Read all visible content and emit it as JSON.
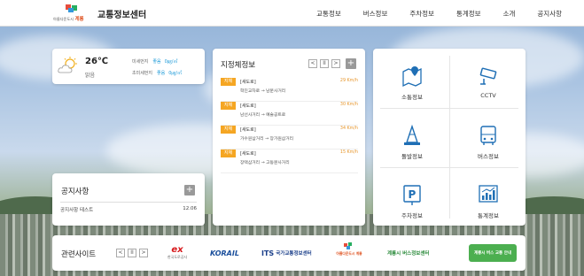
{
  "header": {
    "site_title": "교통정보센터",
    "logo_text": "아름다운도시 계룡",
    "nav": [
      "교통정보",
      "버스정보",
      "주차정보",
      "통계정보",
      "소개",
      "공지사항"
    ]
  },
  "weather": {
    "temp": "26℃",
    "sky": "맑음",
    "dust": [
      {
        "label": "미세먼지",
        "grade": "좋음",
        "value": "0㎍/㎥"
      },
      {
        "label": "초미세먼지",
        "grade": "좋음",
        "value": "0㎍/㎥"
      }
    ]
  },
  "notice": {
    "title": "공지사항",
    "items": [
      {
        "title": "공지사항 테스트",
        "date": "12.06"
      }
    ]
  },
  "congestion": {
    "title": "지정체정보",
    "controls": [
      "<",
      "II",
      ">"
    ],
    "items": [
      {
        "badge": "지체",
        "road": "[새도로]",
        "route": "학진교차로 → 남문사거리",
        "speed": "29 Km/h"
      },
      {
        "badge": "지체",
        "road": "[새도로]",
        "route": "남선사거리 → 예술공트로",
        "speed": "30 Km/h"
      },
      {
        "badge": "지체",
        "road": "[새도로]",
        "route": "가수원삼거리 → 장가원삼거리",
        "speed": "34 Km/h"
      },
      {
        "badge": "지체",
        "road": "[새도로]",
        "route": "장택삼거리 → 고동문사거리",
        "speed": "15 Km/h"
      }
    ]
  },
  "menu": [
    {
      "label": "소통정보",
      "icon": "map-icon"
    },
    {
      "label": "CCTV",
      "icon": "cctv-icon"
    },
    {
      "label": "돌발정보",
      "icon": "traffic-cone-icon"
    },
    {
      "label": "버스정보",
      "icon": "bus-icon"
    },
    {
      "label": "주차정보",
      "icon": "parking-icon"
    },
    {
      "label": "통계정보",
      "icon": "chart-icon"
    }
  ],
  "related": {
    "title": "관련사이트",
    "controls": [
      "<",
      "II",
      ">"
    ],
    "partners": [
      {
        "name": "ex",
        "sub": "한국도로공사",
        "color": "#d7191c"
      },
      {
        "name": "KORAIL",
        "sub": "",
        "color": "#1b4f9c"
      },
      {
        "name": "국가교통정보센터",
        "sub": "",
        "color": "#1b3f8a"
      },
      {
        "name": "아름다운도시 계룡",
        "sub": "",
        "color": "#e05a2a"
      },
      {
        "name": "계룡시 버스정보센터",
        "sub": "",
        "color": "#2a8a3a"
      },
      {
        "name": "계룡시 버스 교통 안내",
        "sub": "",
        "color": "#3aa13a"
      }
    ]
  }
}
